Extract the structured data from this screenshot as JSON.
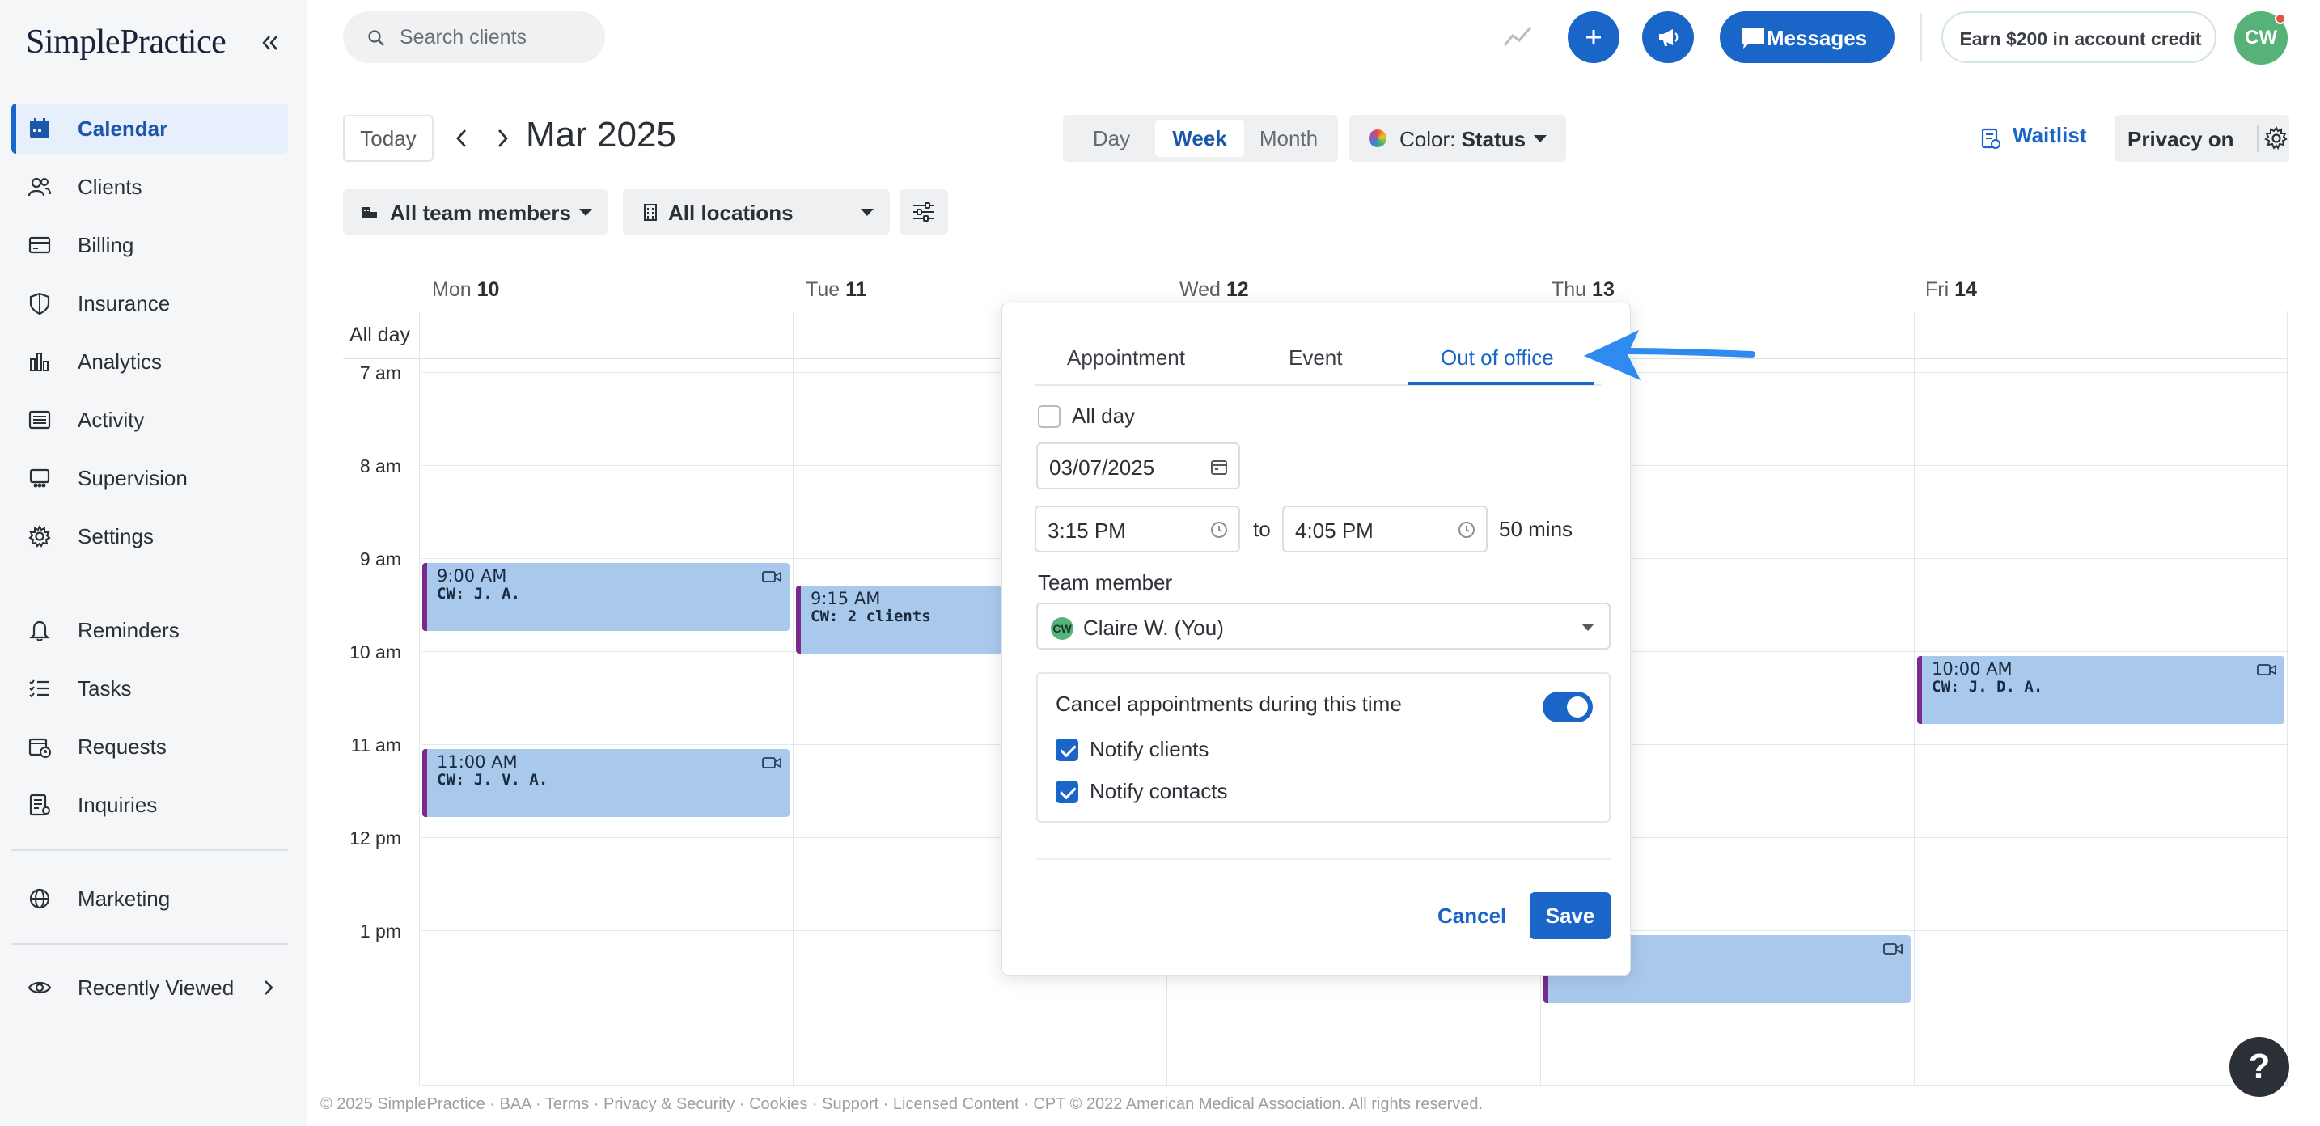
{
  "sidebar": {
    "logo": "SimplePractice",
    "items": [
      {
        "label": "Calendar",
        "icon": "calendar-icon",
        "active": true
      },
      {
        "label": "Clients",
        "icon": "clients-icon"
      },
      {
        "label": "Billing",
        "icon": "billing-icon"
      },
      {
        "label": "Insurance",
        "icon": "shield-icon"
      },
      {
        "label": "Analytics",
        "icon": "bar-chart-icon"
      },
      {
        "label": "Activity",
        "icon": "activity-icon"
      },
      {
        "label": "Supervision",
        "icon": "supervision-icon"
      },
      {
        "label": "Settings",
        "icon": "gear-icon"
      },
      {
        "label": "Reminders",
        "icon": "bell-icon"
      },
      {
        "label": "Tasks",
        "icon": "tasks-icon"
      },
      {
        "label": "Requests",
        "icon": "requests-icon"
      },
      {
        "label": "Inquiries",
        "icon": "inquiries-icon"
      },
      {
        "label": "Marketing",
        "icon": "globe-icon"
      },
      {
        "label": "Recently Viewed",
        "icon": "eye-icon"
      }
    ]
  },
  "topbar": {
    "search_placeholder": "Search clients",
    "messages_label": "Messages",
    "credit_label": "Earn $200 in account credit",
    "avatar_initials": "CW"
  },
  "toolbar": {
    "today_label": "Today",
    "month_title": "Mar 2025",
    "views": [
      "Day",
      "Week",
      "Month"
    ],
    "active_view": "Week",
    "color_label": "Color:",
    "color_value": "Status",
    "waitlist_label": "Waitlist",
    "privacy_label": "Privacy on",
    "team_filter": "All team members",
    "location_filter": "All locations"
  },
  "calendar": {
    "days": [
      {
        "dow": "Mon",
        "num": "10"
      },
      {
        "dow": "Tue",
        "num": "11"
      },
      {
        "dow": "Wed",
        "num": "12"
      },
      {
        "dow": "Thu",
        "num": "13"
      },
      {
        "dow": "Fri",
        "num": "14"
      }
    ],
    "allday_label": "All day",
    "hours": [
      "7 am",
      "8 am",
      "9 am",
      "10 am",
      "11 am",
      "12 pm",
      "1 pm"
    ],
    "appointments": [
      {
        "time": "9:00 AM",
        "who": "CW: J. A."
      },
      {
        "time": "9:15 AM",
        "who": "CW: 2 clients"
      },
      {
        "time": "11:00 AM",
        "who": "CW: J. V. A."
      },
      {
        "time": "10:00 AM",
        "who": "CW: J. D. A."
      }
    ]
  },
  "modal": {
    "tabs": [
      "Appointment",
      "Event",
      "Out of office"
    ],
    "active_tab": "Out of office",
    "allday_label": "All day",
    "date": "03/07/2025",
    "start_time": "3:15 PM",
    "to_label": "to",
    "end_time": "4:05 PM",
    "duration": "50 mins",
    "team_member_label": "Team member",
    "team_member_initials": "CW",
    "team_member_value": "Claire W. (You)",
    "cancel_appointments_label": "Cancel appointments during this time",
    "notify_clients_label": "Notify clients",
    "notify_contacts_label": "Notify contacts",
    "cancel_label": "Cancel",
    "save_label": "Save"
  },
  "footer": {
    "text": "© 2025 SimplePractice · BAA · Terms · Privacy & Security · Cookies · Support · Licensed Content · CPT © 2022 American Medical Association. All rights reserved."
  },
  "colors": {
    "accent": "#1a66c8",
    "appointment": "#a9c9ec",
    "appointment_border": "#7a2a8c",
    "annotation_arrow": "#2e8cf0"
  }
}
